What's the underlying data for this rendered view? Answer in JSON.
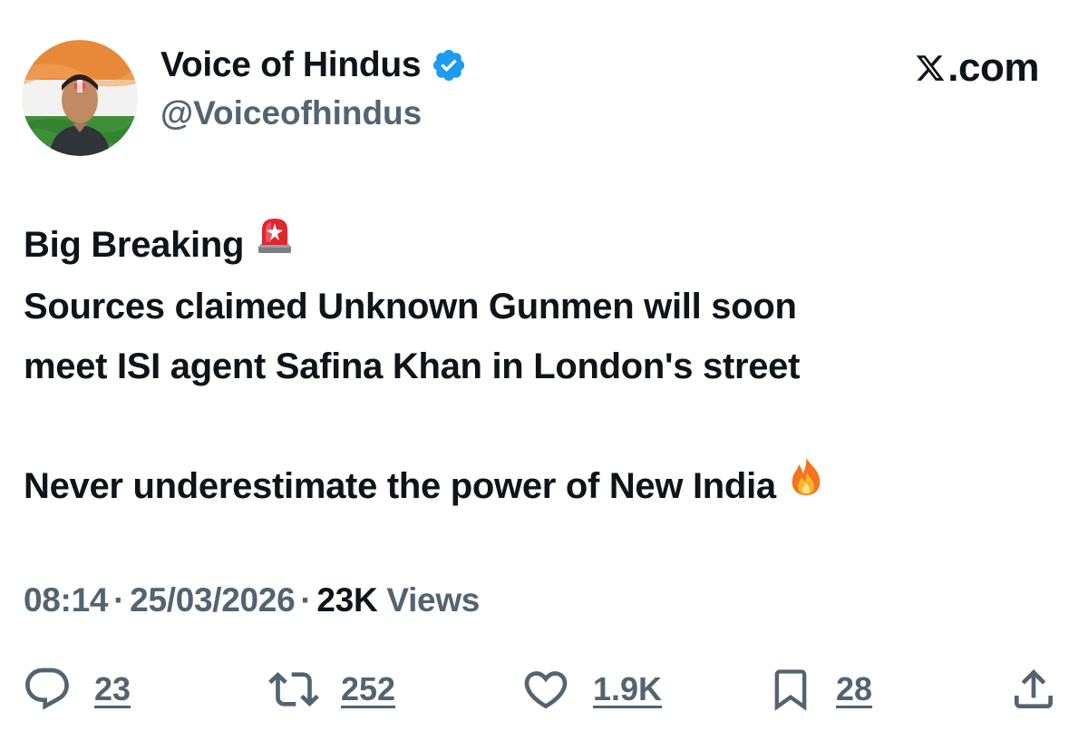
{
  "author": {
    "display_name": "Voice of Hindus",
    "handle": "@Voiceofhindus",
    "verified_icon": "verified-badge-icon",
    "avatar": "avatar-image"
  },
  "brand": {
    "label": ".com",
    "icon": "x-logo-icon"
  },
  "tweet": {
    "line1": "Big Breaking",
    "line1_emoji": "police-light-emoji",
    "line2": "Sources claimed Unknown Gunmen will soon",
    "line3": "meet ISI agent Safina Khan in London's street",
    "line4": "Never underestimate the power of New India",
    "line4_emoji": "fire-emoji"
  },
  "meta": {
    "time": "08:14",
    "separator": "·",
    "date": "25/03/2026",
    "views_count": "23K",
    "views_label": "Views"
  },
  "actions": {
    "replies": "23",
    "reposts": "252",
    "likes": "1.9K",
    "bookmarks": "28",
    "icons": [
      "reply-icon",
      "repost-icon",
      "like-icon",
      "bookmark-icon",
      "share-icon"
    ]
  },
  "colors": {
    "text_primary": "#0f1419",
    "text_secondary": "#536471",
    "verified_blue": "#1d9bf0"
  }
}
